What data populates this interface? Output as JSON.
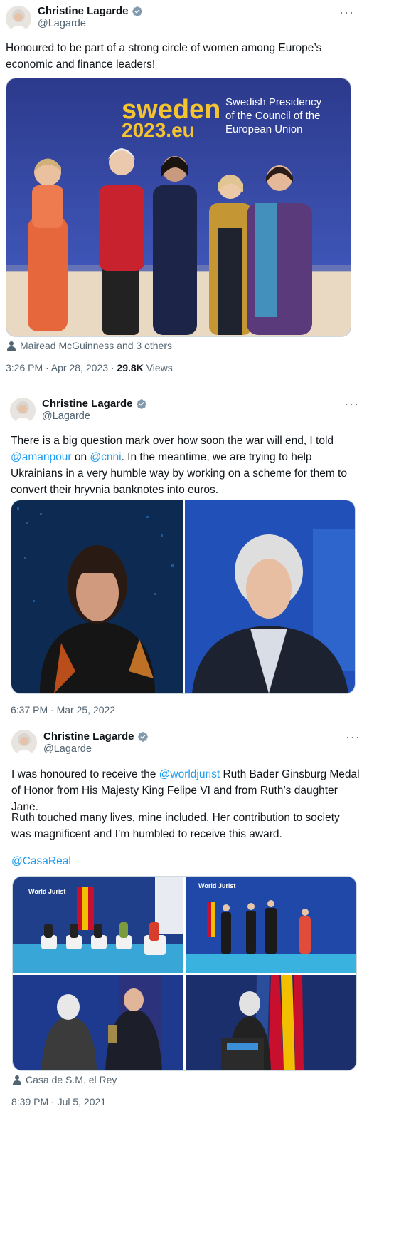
{
  "tweets": [
    {
      "author": "Christine Lagarde",
      "handle": "@Lagarde",
      "more": "···",
      "text": "Honoured to be part of a strong circle of women among Europe’s economic and finance leaders!",
      "tagged": "Mairead McGuinness and 3 others",
      "time": "3:26 PM · Apr 28, 2023 · ",
      "views_count": "29.8K",
      "views_label": " Views",
      "image": {
        "banner_line1": "sweden",
        "banner_line2": "2023.eu",
        "banner_text1": "Swedish Presidency",
        "banner_text2": "of the Council of the",
        "banner_text3": "European Union"
      }
    },
    {
      "author": "Christine Lagarde",
      "handle": "@Lagarde",
      "more": "···",
      "text_part1": "There is a big question mark over how soon the war will end, I told ",
      "mention1": "@amanpour",
      "text_part2": " on ",
      "mention2": "@cnni",
      "text_part3": ". In the meantime, we are trying to help Ukrainians in a very humble way by working on a scheme for them to convert their hryvnia banknotes into euros.",
      "time": "6:37 PM · Mar 25, 2022"
    },
    {
      "author": "Christine Lagarde",
      "handle": "@Lagarde",
      "more": "···",
      "text_part1": "I was honoured to receive the ",
      "mention1": "@worldjurist",
      "text_part2": " Ruth Bader Ginsburg Medal of Honor from His Majesty King Felipe VI and from Ruth’s daughter Jane.",
      "text_para2": "Ruth touched many lives, mine included. Her contribution to society was magnificent and I’m humbled to receive this award.",
      "mention2": "@CasaReal",
      "tagged": "Casa de S.M. el Rey",
      "time": "8:39 PM · Jul 5, 2021",
      "image": {
        "logo_text": "World Jurist"
      }
    }
  ],
  "colors": {
    "link": "#1d9bf0",
    "verified": "#829aab",
    "secondary_text": "#536471"
  }
}
